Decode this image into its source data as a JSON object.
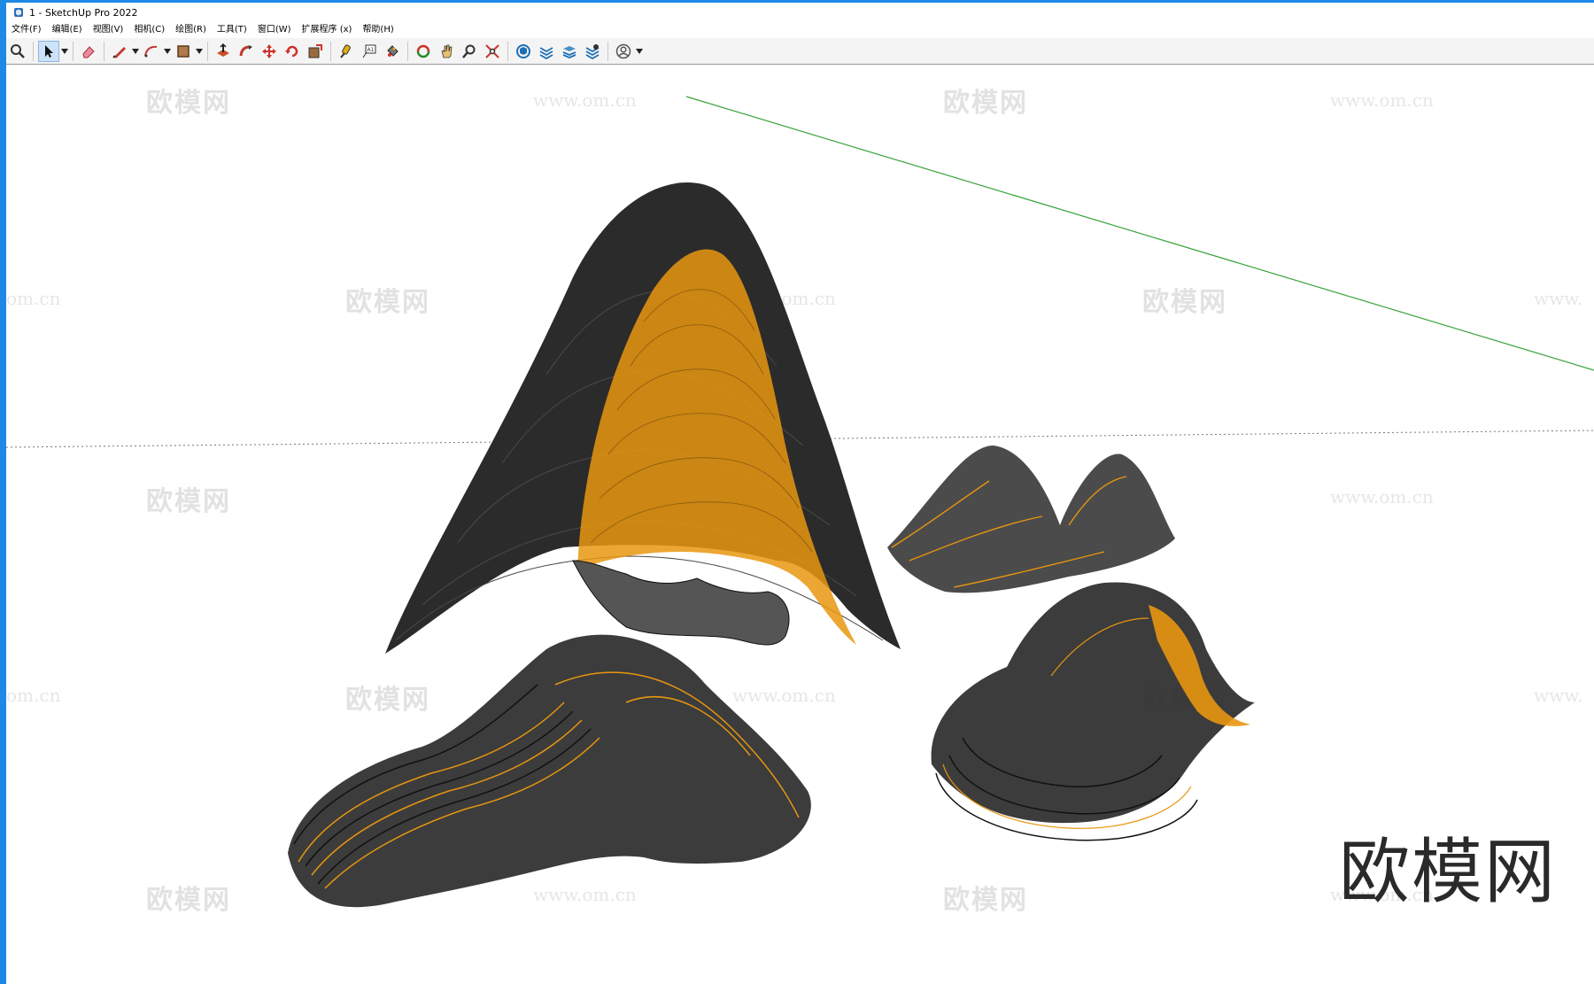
{
  "window": {
    "title": "1 - SketchUp Pro 2022"
  },
  "menu": [
    {
      "label": "文件(F)"
    },
    {
      "label": "编辑(E)"
    },
    {
      "label": "视图(V)"
    },
    {
      "label": "相机(C)"
    },
    {
      "label": "绘图(R)"
    },
    {
      "label": "工具(T)"
    },
    {
      "label": "窗口(W)"
    },
    {
      "label": "扩展程序 (x)"
    },
    {
      "label": "帮助(H)"
    }
  ],
  "toolbar": {
    "tools": [
      {
        "icon": "zoom-icon"
      },
      {
        "icon": "select-arrow-icon",
        "selected": true
      },
      {
        "icon": "eraser-icon"
      },
      {
        "icon": "pencil-line-icon"
      },
      {
        "icon": "arc-icon"
      },
      {
        "icon": "rectangle-icon"
      },
      {
        "icon": "push-pull-icon"
      },
      {
        "icon": "follow-me-icon"
      },
      {
        "icon": "move-icon"
      },
      {
        "icon": "rotate-icon"
      },
      {
        "icon": "scale-icon"
      },
      {
        "icon": "tape-measure-icon"
      },
      {
        "icon": "text-icon"
      },
      {
        "icon": "paint-bucket-icon"
      },
      {
        "icon": "orbit-icon"
      },
      {
        "icon": "pan-icon"
      },
      {
        "icon": "zoom-window-icon"
      },
      {
        "icon": "zoom-extents-icon"
      },
      {
        "icon": "3d-warehouse-icon"
      },
      {
        "icon": "extension-warehouse-icon"
      },
      {
        "icon": "layout-icon"
      },
      {
        "icon": "extension-manager-icon"
      },
      {
        "icon": "account-icon"
      }
    ]
  },
  "watermarks": {
    "logo_text": "欧模网",
    "url_text": "www.om.cn",
    "partial_url_text": "om.cn",
    "partial_url_right": "www."
  },
  "brand": {
    "text": "欧模网",
    "color": "#2a2a2a"
  },
  "colors": {
    "accent_orange": "#e8960f",
    "dark_surface": "#2b2b2b",
    "green_axis": "#3aa33a",
    "window_border": "#1e88e5"
  }
}
